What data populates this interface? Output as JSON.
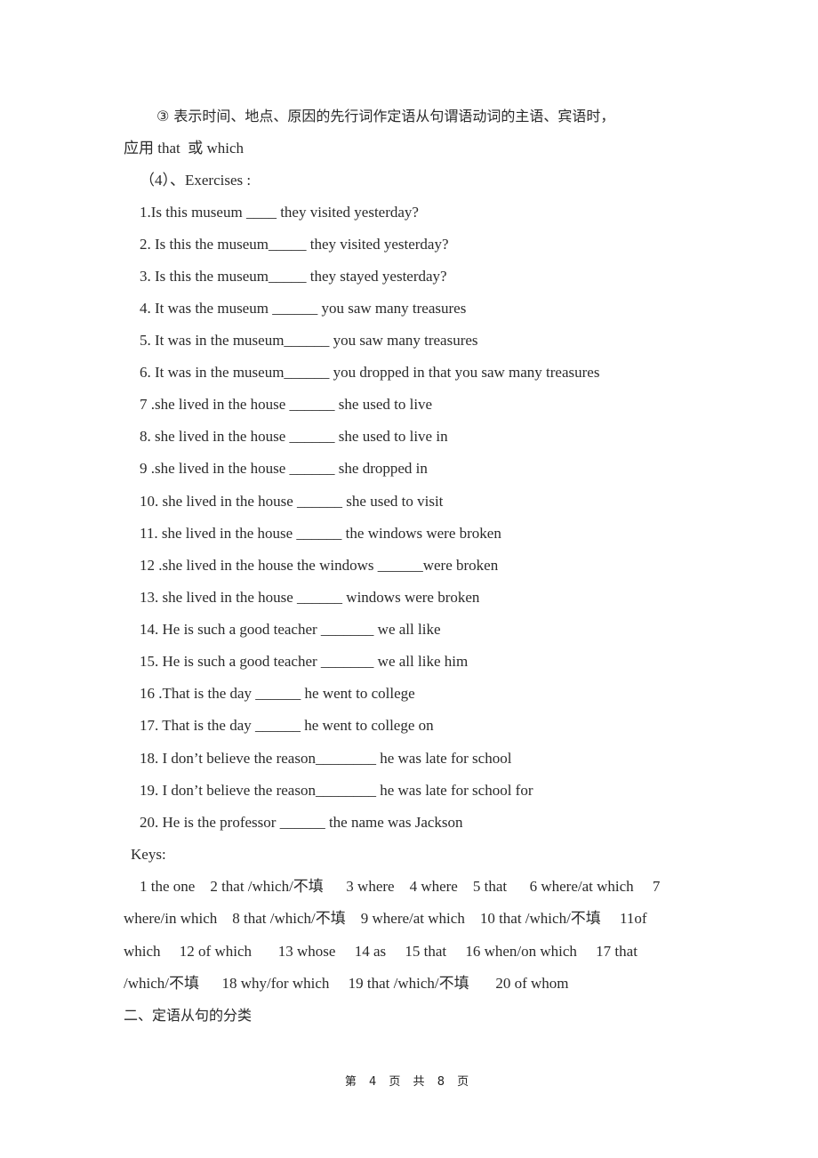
{
  "rule3": {
    "line1": "③ 表示时间、地点、原因的先行词作定语从句谓语动词的主语、宾语时，",
    "line2": "应用 that  或 which"
  },
  "exercises_heading": "（4）、Exercises :",
  "exercises": [
    "1.Is this museum ____ they visited yesterday?",
    "2. Is this the museum_____ they visited yesterday?",
    "3. Is this the museum_____ they stayed yesterday?",
    "4. It was the museum ______ you saw many treasures",
    "5. It was in the museum______ you saw many treasures",
    "6. It was in the museum______ you dropped in that you saw many treasures",
    "7 .she lived in the house ______ she used to live",
    "8. she lived in the house ______ she used to live in",
    "9 .she lived in the house ______ she dropped in",
    "10. she lived in the house ______ she used to visit",
    "11. she lived in the house ______ the windows were broken",
    "12 .she lived in the house the windows ______were broken",
    "13. she lived in the house ______ windows were broken",
    "14. He is such a good teacher _______ we all like",
    "15. He is such a good teacher _______ we all like him",
    "16 .That is the day ______ he went to college",
    "17. That is the day ______ he went to college on",
    "18. I don’t believe the reason________ he was late for school",
    "19. I don’t believe the reason________ he was late for school for",
    "20. He is the professor ______ the name was Jackson"
  ],
  "keys_heading": "Keys:",
  "keys_lines": [
    "1 the one    2 that /which/不填      3 where    4 where    5 that      6 where/at which     7",
    "where/in which    8 that /which/不填    9 where/at which    10 that /which/不填     11of",
    "which     12 of which       13 whose     14 as     15 that     16 when/on which     17 that",
    "/which/不填      18 why/for which     19 that /which/不填       20 of whom"
  ],
  "section_heading": "二、定语从句的分类",
  "footer": "第 4 页 共 8 页"
}
